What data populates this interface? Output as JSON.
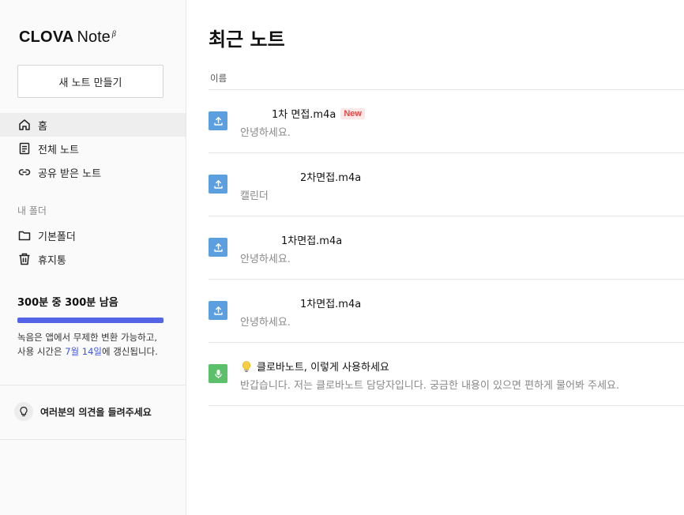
{
  "brand": {
    "name": "CLOVA",
    "product": "Note",
    "beta": "β"
  },
  "sidebar": {
    "new_note_label": "새 노트 만들기",
    "nav": [
      {
        "label": "홈",
        "icon": "home-icon",
        "active": true
      },
      {
        "label": "전체 노트",
        "icon": "document-icon",
        "active": false
      },
      {
        "label": "공유 받은 노트",
        "icon": "link-icon",
        "active": false
      }
    ],
    "folders_label": "내 폴더",
    "folders": [
      {
        "label": "기본폴더",
        "icon": "folder-icon"
      },
      {
        "label": "휴지통",
        "icon": "trash-icon"
      }
    ],
    "usage": {
      "title": "300분 중 300분 남음",
      "fraction": 1.0,
      "desc_line1": "녹음은 앱에서 무제한 변환 가능하고,",
      "desc_prefix": "사용 시간은 ",
      "desc_date": "7월 14일",
      "desc_suffix": "에 갱신됩니다."
    },
    "feedback_label": "여러분의 의견을 들려주세요"
  },
  "main": {
    "title": "최근 노트",
    "column_name": "이름",
    "notes": [
      {
        "title": "1차 면접.m4a",
        "badge": "New",
        "subtitle": "안녕하세요.",
        "type": "upload"
      },
      {
        "title": "2차면접.m4a",
        "badge": "",
        "subtitle": "캘린더",
        "type": "upload"
      },
      {
        "title": "1차면접.m4a",
        "badge": "",
        "subtitle": "안녕하세요.",
        "type": "upload"
      },
      {
        "title": "1차면접.m4a",
        "badge": "",
        "subtitle": "안녕하세요.",
        "type": "upload"
      },
      {
        "title": "클로바노트, 이렇게 사용하세요",
        "badge": "",
        "subtitle": "반갑습니다. 저는 클로바노트 담당자입니다. 궁금한 내용이 있으면 편하게 물어봐 주세요.",
        "type": "mic"
      }
    ]
  },
  "colors": {
    "accent": "#5464e6",
    "upload_icon_bg": "#5b9fe0",
    "mic_icon_bg": "#5cc06a",
    "badge_text": "#e04848"
  }
}
